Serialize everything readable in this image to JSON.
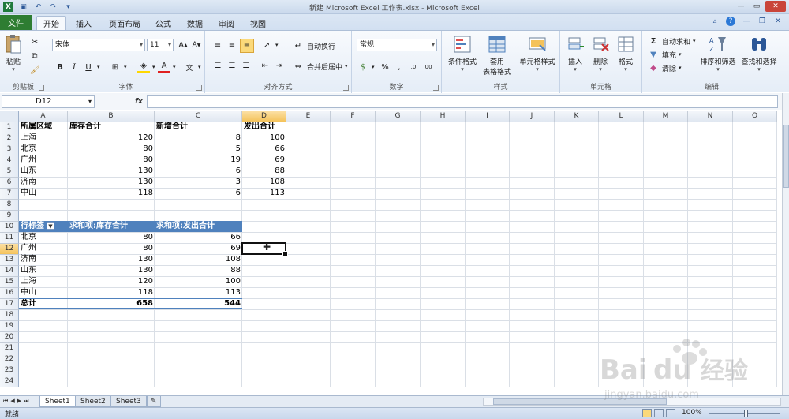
{
  "window": {
    "title": "新建 Microsoft Excel 工作表.xlsx - Microsoft Excel"
  },
  "tabs": {
    "file": "文件",
    "items": [
      "开始",
      "插入",
      "页面布局",
      "公式",
      "数据",
      "审阅",
      "视图"
    ],
    "active": "开始"
  },
  "ribbon": {
    "clipboard": {
      "label": "剪贴板",
      "paste": "粘贴"
    },
    "font": {
      "label": "字体",
      "name": "宋体",
      "size": "11"
    },
    "alignment": {
      "label": "对齐方式",
      "wrap": "自动换行",
      "merge": "合并后居中"
    },
    "number": {
      "label": "数字",
      "format": "常规"
    },
    "styles": {
      "label": "样式",
      "cond": "条件格式",
      "table_top": "套用",
      "table_bottom": "表格格式",
      "cell": "单元格样式"
    },
    "cells": {
      "label": "单元格",
      "insert": "插入",
      "delete": "删除",
      "format": "格式"
    },
    "editing": {
      "label": "编辑",
      "autosum": "自动求和",
      "fill": "填充",
      "clear": "清除",
      "sort": "排序和筛选",
      "find": "查找和选择"
    }
  },
  "formula_bar": {
    "name_box": "D12",
    "fx": "fx",
    "value": ""
  },
  "columns": [
    "A",
    "B",
    "C",
    "D",
    "E",
    "F",
    "G",
    "H",
    "I",
    "J",
    "K",
    "L",
    "M",
    "N",
    "O"
  ],
  "rows": [
    "1",
    "2",
    "3",
    "4",
    "5",
    "6",
    "7",
    "8",
    "9",
    "10",
    "11",
    "12",
    "13",
    "14",
    "15",
    "16",
    "17",
    "18",
    "19",
    "20",
    "21",
    "22",
    "23",
    "24"
  ],
  "table": {
    "headers": [
      "所属区域",
      "库存合计",
      "新增合计",
      "发出合计"
    ],
    "rows": [
      [
        "上海",
        "120",
        "8",
        "100"
      ],
      [
        "北京",
        "80",
        "5",
        "66"
      ],
      [
        "广州",
        "80",
        "19",
        "69"
      ],
      [
        "山东",
        "130",
        "6",
        "88"
      ],
      [
        "济南",
        "130",
        "3",
        "108"
      ],
      [
        "中山",
        "118",
        "6",
        "113"
      ]
    ]
  },
  "pivot": {
    "headers": [
      "行标签",
      "求和项:库存合计",
      "求和项:发出合计"
    ],
    "rows": [
      [
        "北京",
        "80",
        "66"
      ],
      [
        "广州",
        "80",
        "69"
      ],
      [
        "济南",
        "130",
        "108"
      ],
      [
        "山东",
        "130",
        "88"
      ],
      [
        "上海",
        "120",
        "100"
      ],
      [
        "中山",
        "118",
        "113"
      ]
    ],
    "total": [
      "总计",
      "658",
      "544"
    ]
  },
  "sheets": [
    "Sheet1",
    "Sheet2",
    "Sheet3"
  ],
  "status": {
    "ready": "就绪",
    "zoom": "100%"
  },
  "watermark": {
    "brand": "Bai",
    "brand_cn": "经验",
    "url": "jingyan.baidu.com"
  }
}
